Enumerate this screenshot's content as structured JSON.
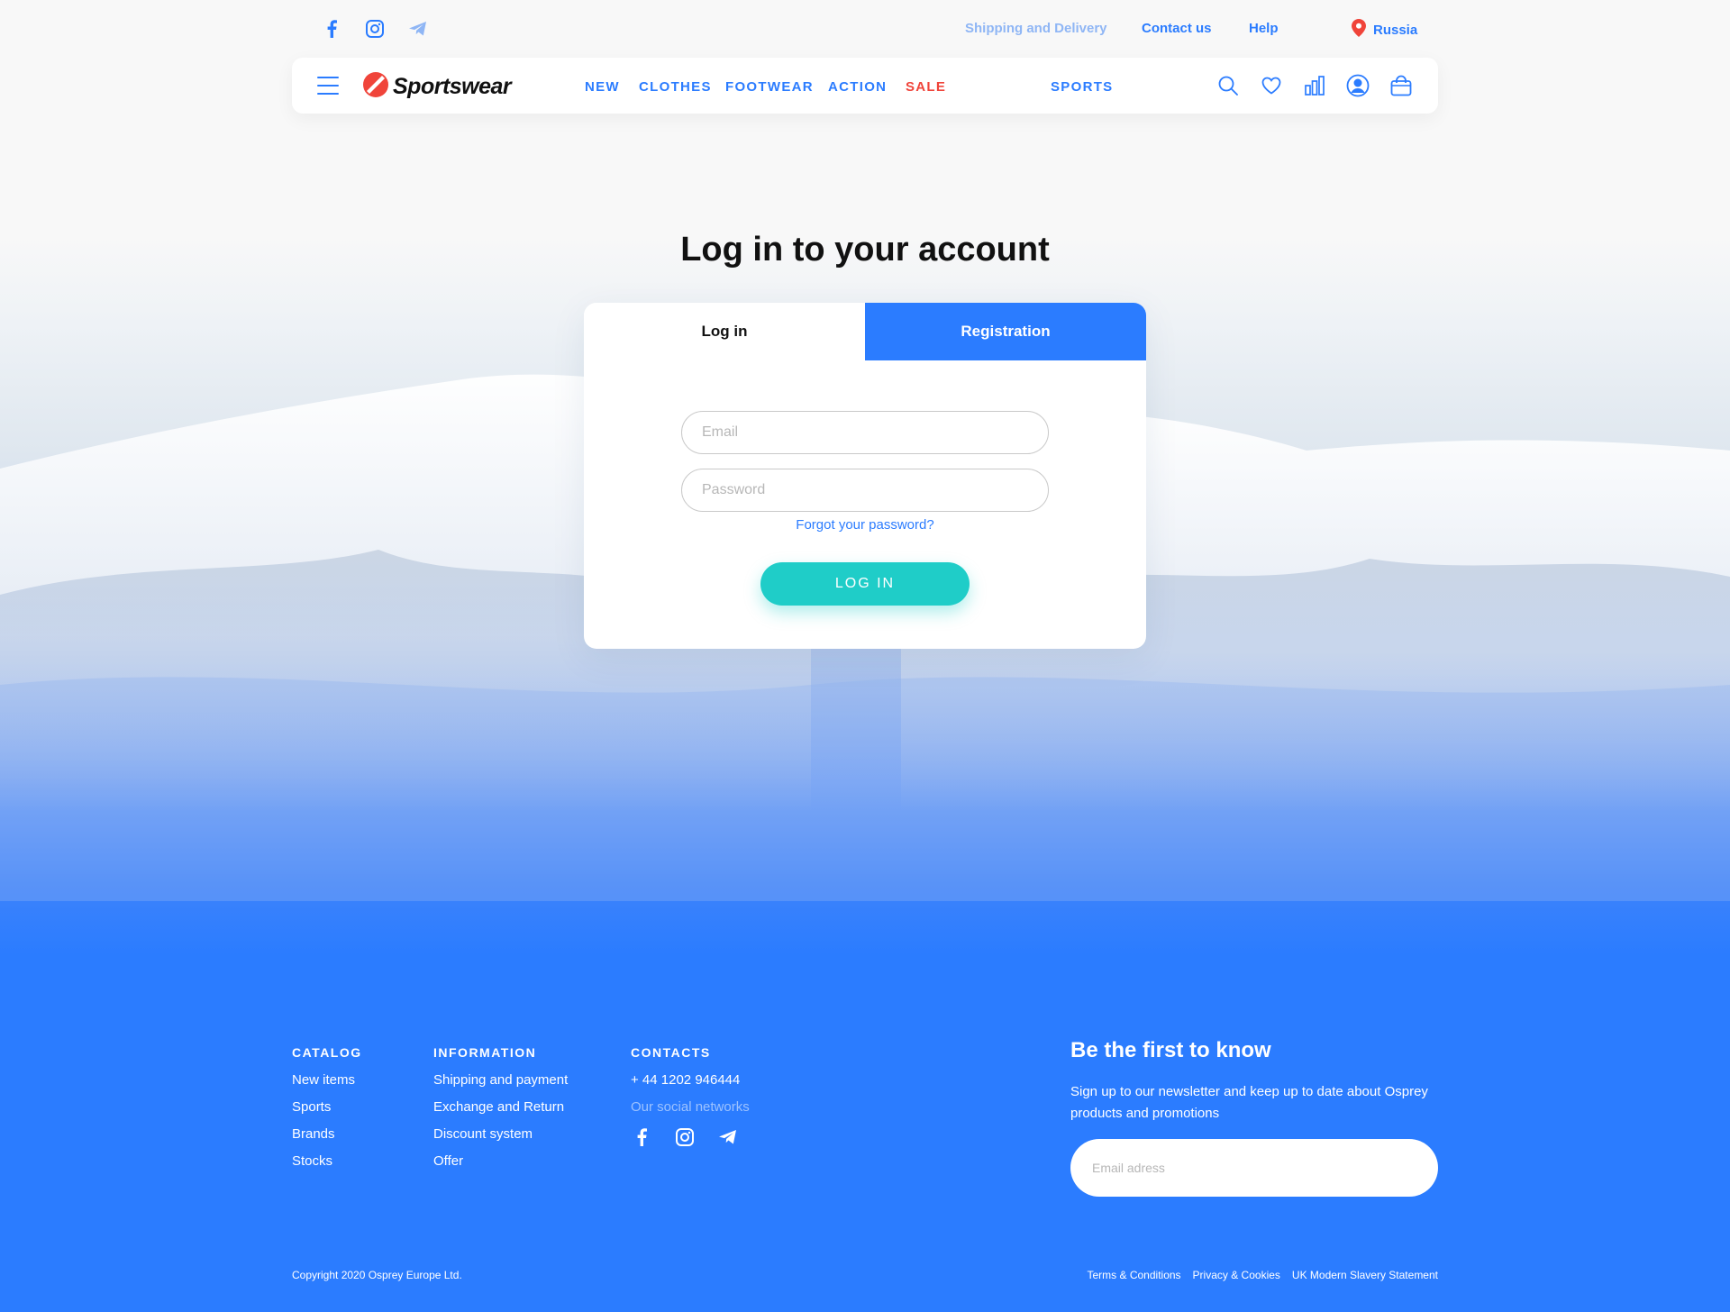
{
  "top_bar": {
    "social_icons": [
      "facebook-icon",
      "instagram-icon",
      "telegram-icon"
    ],
    "shipping_link": "Shipping and Delivery",
    "contact_link": "Contact us",
    "help_link": "Help",
    "region": "Russia"
  },
  "header": {
    "logo_text": "Sportswear",
    "nav": {
      "new": "NEW",
      "clothes": "CLOTHES",
      "footwear": "FOOTWEAR",
      "action": "ACTION",
      "sale": "SALE",
      "sports": "SPORTS"
    },
    "icons": [
      "search-icon",
      "heart-icon",
      "compare-icon",
      "user-icon",
      "cart-icon"
    ]
  },
  "login": {
    "title": "Log in to your account",
    "tab_login": "Log in",
    "tab_registration": "Registration",
    "email_placeholder": "Email",
    "password_placeholder": "Password",
    "forgot": "Forgot your password?",
    "button": "LOG IN"
  },
  "footer": {
    "catalog": {
      "title": "CATALOG",
      "items": [
        "New items",
        "Sports",
        "Brands",
        "Stocks"
      ]
    },
    "information": {
      "title": "INFORMATION",
      "items": [
        "Shipping and payment",
        "Exchange and Return",
        "Discount system",
        "Offer"
      ]
    },
    "contacts": {
      "title": "CONTACTS",
      "phone": "+ 44 1202 946444",
      "social_label": "Our social networks"
    },
    "newsletter": {
      "title": "Be the first to know",
      "text": "Sign up to our newsletter and keep up to date about Osprey products and promotions",
      "placeholder": "Email adress"
    },
    "copyright": "Copyright 2020 Osprey Europe Ltd.",
    "legal": [
      "Terms & Conditions",
      "Privacy & Cookies",
      "UK Modern Slavery Statement"
    ]
  },
  "colors": {
    "accent": "#2b7cff",
    "sale": "#f0443a",
    "button": "#1fcdc8",
    "footer_bg": "#2b7cff"
  }
}
